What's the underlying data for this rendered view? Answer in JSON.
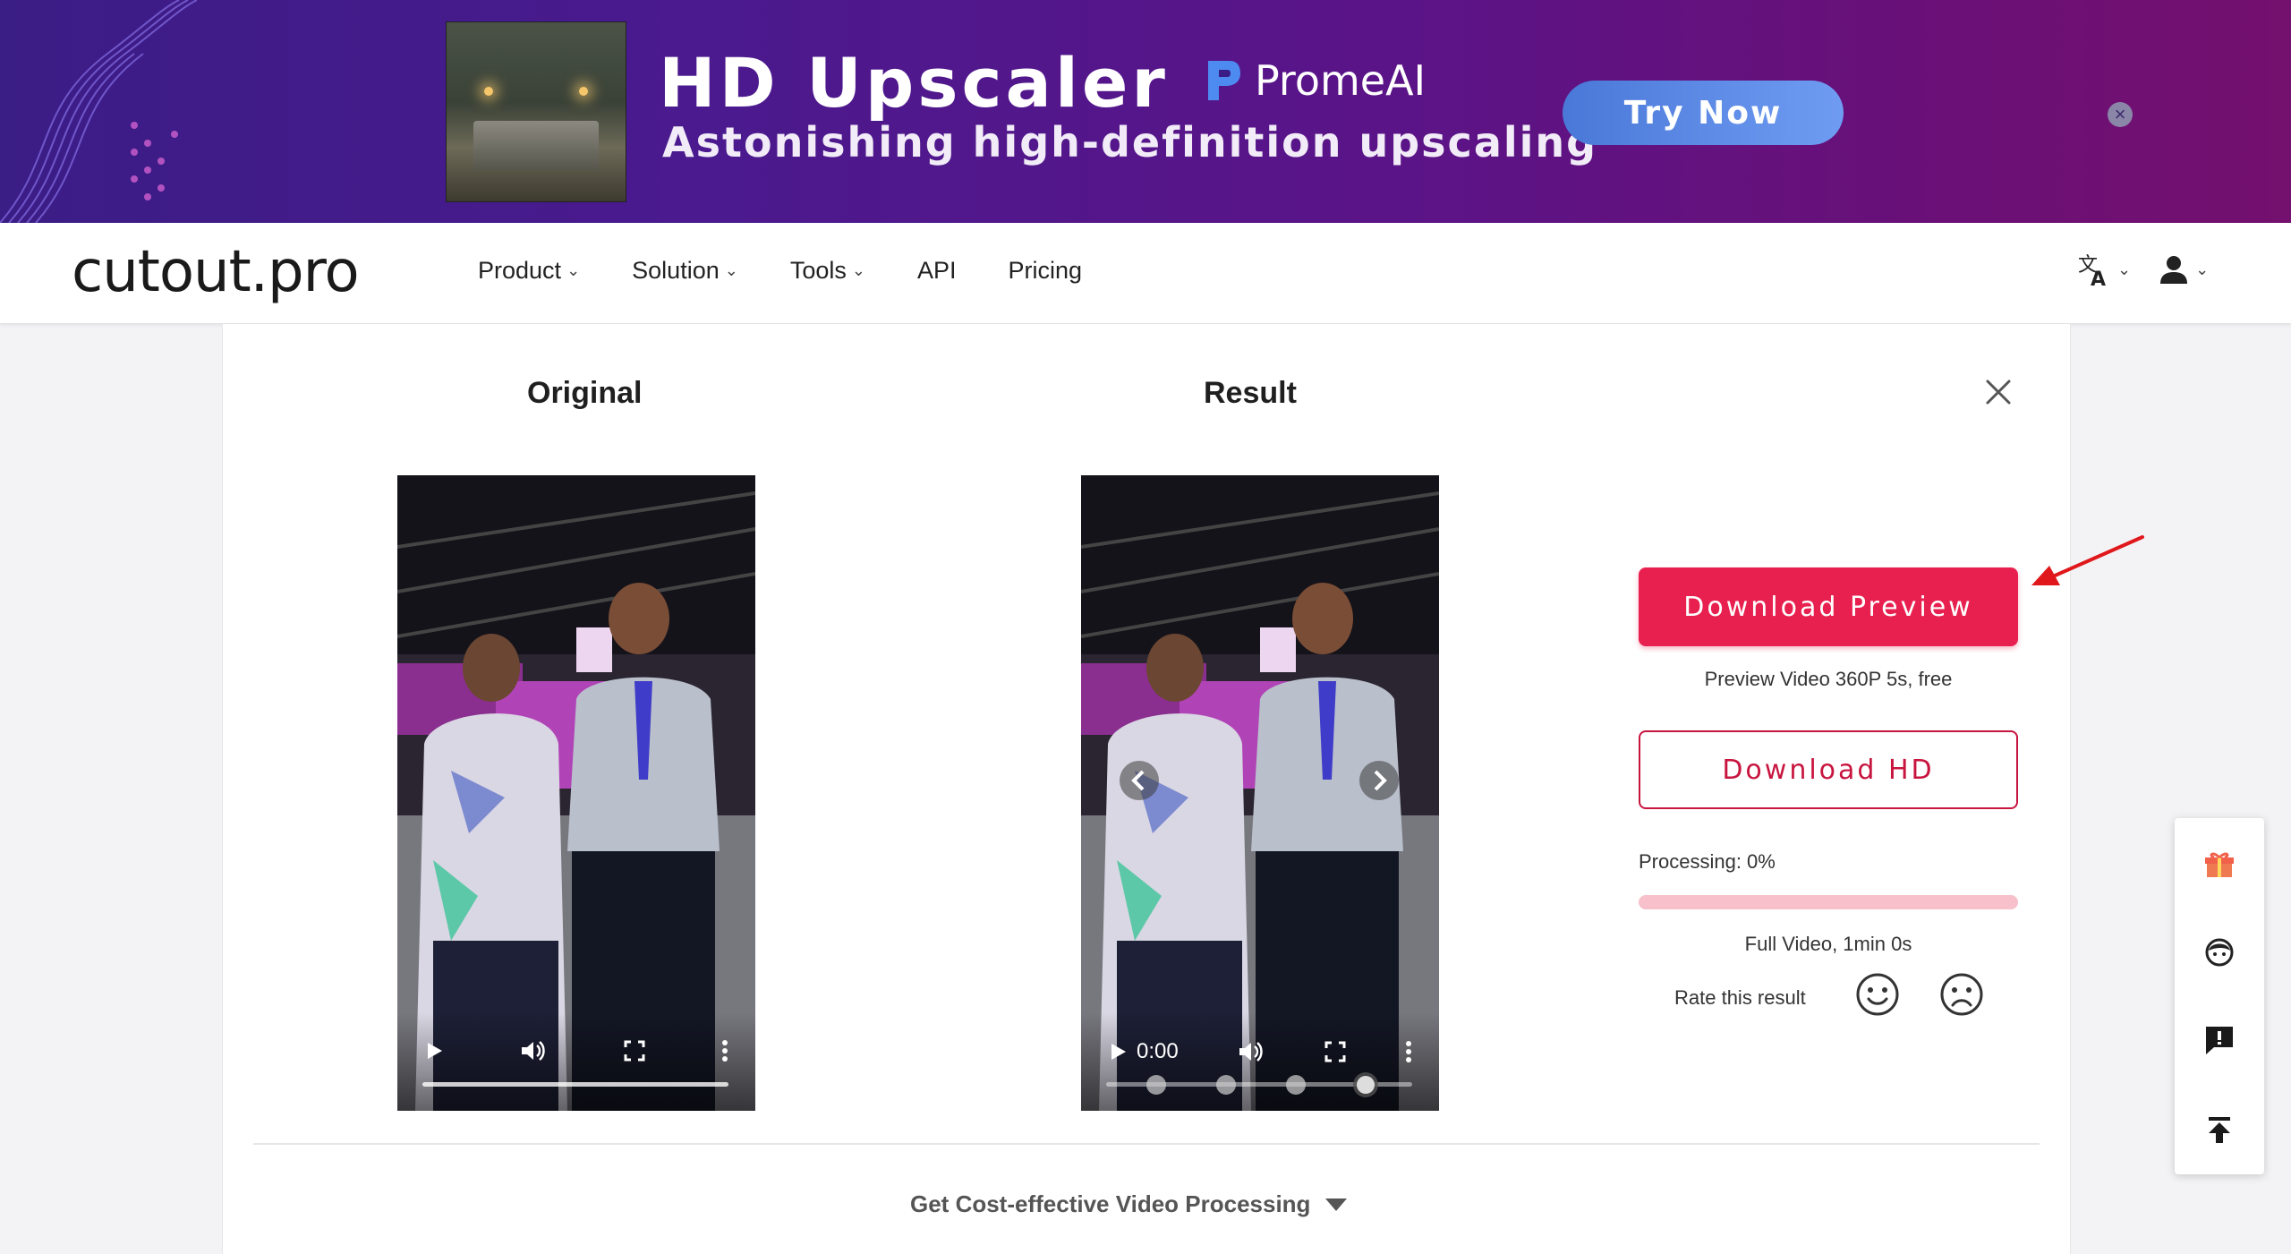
{
  "ad": {
    "title": "HD Upscaler",
    "subtitle": "Astonishing high-definition upscaling",
    "brand": "PromeAI",
    "cta": "Try Now",
    "close_glyph": "×",
    "colors": {
      "bg_start": "#3b1d86",
      "bg_end": "#74106e",
      "cta": "#5b8ae6"
    }
  },
  "nav": {
    "logo": "cutout.pro",
    "menu": [
      {
        "label": "Product",
        "has_dropdown": true
      },
      {
        "label": "Solution",
        "has_dropdown": true
      },
      {
        "label": "Tools",
        "has_dropdown": true
      },
      {
        "label": "API",
        "has_dropdown": false
      },
      {
        "label": "Pricing",
        "has_dropdown": false
      }
    ],
    "chevron": "⌄",
    "icons": [
      "translate-icon",
      "user-icon"
    ]
  },
  "panel": {
    "original_title": "Original",
    "result_title": "Result",
    "original_video": {
      "show_time": false
    },
    "result_video": {
      "time": "0:00"
    },
    "download_preview": "Download Preview",
    "preview_note": "Preview Video 360P 5s, free",
    "download_hd": "Download HD",
    "processing_label": "Processing: 0%",
    "processing_progress": 0,
    "full_note": "Full Video, 1min 0s",
    "rate_label": "Rate this result",
    "cost_label": "Get Cost-effective Video Processing",
    "colors": {
      "primary": "#e8204f",
      "primary_dark": "#c8153f",
      "track": "#f7c0cb"
    }
  },
  "float_bar": {
    "icons": [
      "gift-icon",
      "support-agent-icon",
      "feedback-icon",
      "back-to-top-icon"
    ]
  }
}
